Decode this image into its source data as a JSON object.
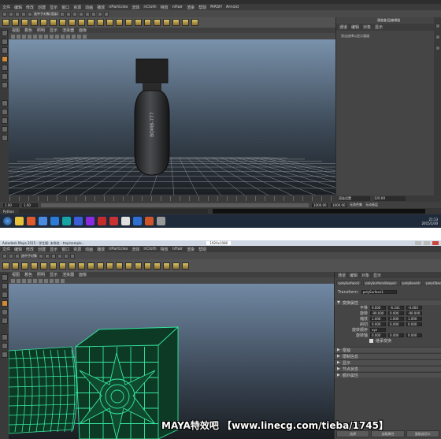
{
  "screenshot1": {
    "menus": [
      "文件",
      "编辑",
      "修改",
      "创建",
      "显示",
      "窗口",
      "资源",
      "动画",
      "播放",
      "nParticles",
      "流体",
      "nCloth",
      "特效",
      "nHair",
      "渲染",
      "帮助",
      "MASH",
      "Arnold"
    ],
    "viewport_menus": [
      "视图",
      "着色",
      "照明",
      "显示",
      "渲染器",
      "面板"
    ],
    "shelf_label": "选中子对象(渲染)",
    "panel_title": "通道盒/层编辑器",
    "panel_tabs": [
      "通道",
      "编辑",
      "对象",
      "显示"
    ],
    "panel_text": "双击选择以显示通道",
    "object_label": "BOMB-777",
    "timeline_start": "1.00",
    "timeline_end": "120.00",
    "range_start": "1.00",
    "range_end": "1.00",
    "anim_end": "1000.00",
    "anim_end2": "1000.00",
    "no_char_set": "无角色集",
    "no_anim_layer": "无动画层",
    "command_label": "Python",
    "render_label": "渲染设置",
    "clock_time": "21:13",
    "clock_date": "2015/1/30"
  },
  "screenshot2": {
    "title": "Autodesk Maya 2015 - 学生版: 未命名 - tmp/sample...",
    "window_ctrl": "1920x1080",
    "menus": [
      "文件",
      "编辑",
      "修改",
      "创建",
      "显示",
      "窗口",
      "资源",
      "动画",
      "播放",
      "nParticles",
      "流体",
      "nCloth",
      "特效",
      "nHair",
      "渲染",
      "帮助"
    ],
    "shelf_label": "选中子对象",
    "viewport_menus": [
      "视图",
      "着色",
      "照明",
      "显示",
      "渲染器",
      "面板"
    ],
    "attr_tabs": [
      "polySurface1",
      "polySurfaceShape1",
      "polyBevel1",
      "polyCBox1"
    ],
    "transform_label": "Transform:",
    "transform_value": "polySurface1",
    "section_title": "变换属性",
    "attrs": [
      {
        "label": "平移",
        "values": [
          "0.000",
          "-6.341",
          "-0.000"
        ]
      },
      {
        "label": "旋转",
        "values": [
          "-90.000",
          "0.000",
          "-90.000"
        ]
      },
      {
        "label": "缩放",
        "values": [
          "1.000",
          "1.000",
          "1.000"
        ]
      },
      {
        "label": "斜切",
        "values": [
          "0.000",
          "0.000",
          "0.000"
        ]
      },
      {
        "label": "旋转顺序",
        "values": [
          "xyz"
        ]
      },
      {
        "label": "旋转轴",
        "values": [
          "0.000",
          "0.000",
          "0.000"
        ]
      }
    ],
    "inherit_label": "继承变换",
    "sections": [
      "枢轴",
      "限制信息",
      "显示",
      "节点状态",
      "额外属性"
    ],
    "footer_buttons": [
      "选择",
      "加载属性",
      "复制选项卡"
    ]
  },
  "banner": "MAYA特效吧 【www.linecg.com/tieba/1745】",
  "colors": {
    "wireframe": "#35e8a0",
    "wireframe_dark": "#0d3a25",
    "maya_bg_top": "#7189a4",
    "maya_bg_bottom": "#1a1e22"
  }
}
